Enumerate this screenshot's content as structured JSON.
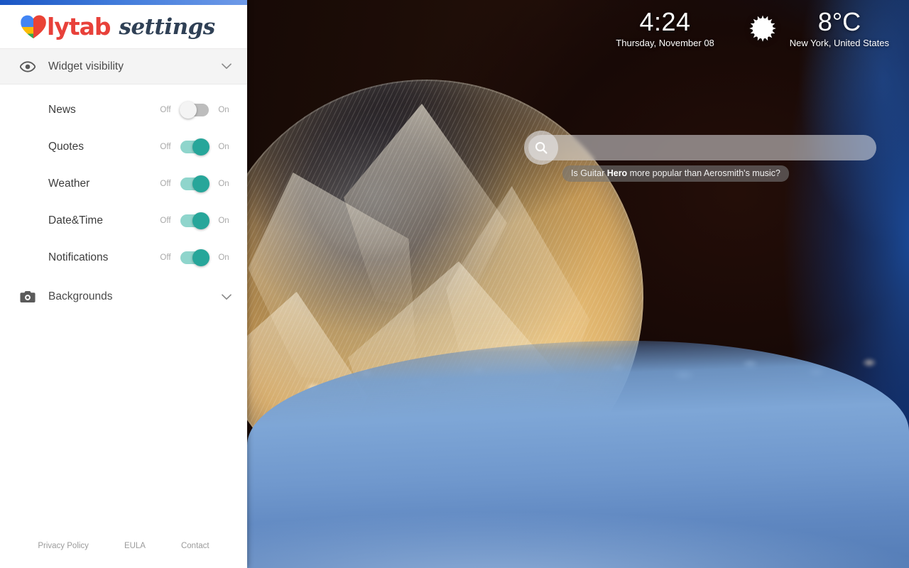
{
  "sidebar": {
    "brand": {
      "name": "lytab",
      "suffix": "settings",
      "logo_icon": "heart-logo"
    },
    "accent_blue_gradient": [
      "#1a56c4",
      "#6e9ae8"
    ],
    "toggle_on_color": "#27a69a",
    "toggle_off_color": "#bdbdbd",
    "sections": [
      {
        "id": "widget-visibility",
        "title": "Widget visibility",
        "icon": "eye-icon",
        "chevron": "chevron-down-icon",
        "expanded": true
      },
      {
        "id": "backgrounds",
        "title": "Backgrounds",
        "icon": "camera-icon",
        "chevron": "chevron-down-icon",
        "expanded": false
      }
    ],
    "widgets": [
      {
        "label": "News",
        "off_label": "Off",
        "on_label": "On",
        "state": "off"
      },
      {
        "label": "Quotes",
        "off_label": "Off",
        "on_label": "On",
        "state": "on"
      },
      {
        "label": "Weather",
        "off_label": "Off",
        "on_label": "On",
        "state": "on"
      },
      {
        "label": "Date&Time",
        "off_label": "Off",
        "on_label": "On",
        "state": "on"
      },
      {
        "label": "Notifications",
        "off_label": "Off",
        "on_label": "On",
        "state": "on"
      }
    ],
    "footer_links": [
      {
        "label": "Privacy Policy"
      },
      {
        "label": "EULA"
      },
      {
        "label": "Contact"
      }
    ]
  },
  "newtab": {
    "clock": {
      "time": "4:24",
      "date": "Thursday, November 08"
    },
    "weather": {
      "icon": "sun-icon",
      "temperature": "8°C",
      "location": "New York, United States"
    },
    "search": {
      "icon": "search-icon",
      "value": "",
      "placeholder": "",
      "suggestion_prefix": "Is Guitar ",
      "suggestion_bold": "Hero",
      "suggestion_suffix": " more popular than Aerosmith's music?"
    },
    "background": {
      "description": "Frozen soap bubble with ice-crystal feather patterns on blue snow at sunrise"
    }
  }
}
